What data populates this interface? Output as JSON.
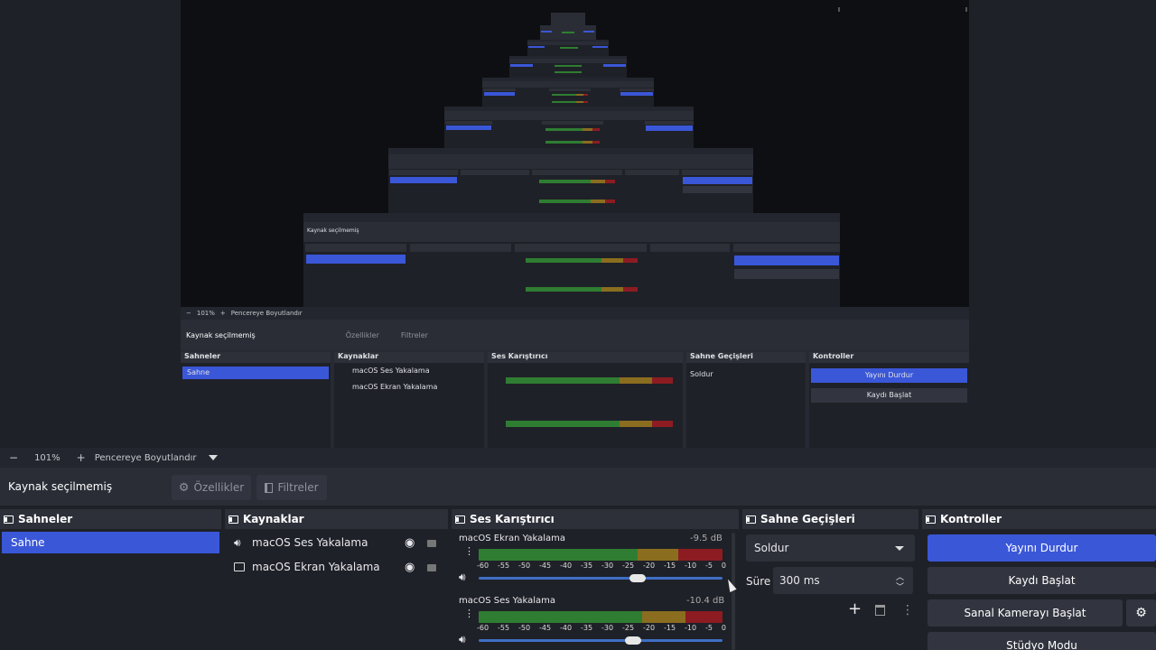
{
  "zoom": {
    "minus": "−",
    "value": "101%",
    "plus": "+",
    "fit": "Pencereye Boyutlandır"
  },
  "source_bar": {
    "title": "Kaynak seçilmemiş",
    "properties": "Özellikler",
    "filters": "Filtreler"
  },
  "scenes": {
    "title": "Sahneler",
    "items": [
      "Sahne"
    ]
  },
  "sources": {
    "title": "Kaynaklar",
    "items": [
      "macOS Ses Yakalama",
      "macOS Ekran Yakalama"
    ]
  },
  "mixer": {
    "title": "Ses Karıştırıcı",
    "channels": [
      {
        "name": "macOS Ekran Yakalama",
        "db": "-9.5 dB",
        "volume": 0.82
      },
      {
        "name": "macOS Ses Yakalama",
        "db": "-10.4 dB",
        "volume": 0.8
      }
    ],
    "ticks": [
      "-60",
      "-55",
      "-50",
      "-45",
      "-40",
      "-35",
      "-30",
      "-25",
      "-20",
      "-15",
      "-10",
      "-5",
      "0"
    ]
  },
  "transitions": {
    "title": "Sahne Geçişleri",
    "type": "Soldur",
    "duration_label": "Süre",
    "duration": "300 ms"
  },
  "controls": {
    "title": "Kontroller",
    "stop_stream": "Yayını Durdur",
    "start_record": "Kaydı Başlat",
    "virtual_cam": "Sanal Kamerayı Başlat",
    "studio_mode": "Stüdyo Modu"
  },
  "colors": {
    "accent": "#3a57d8",
    "bg": "#1f2128",
    "panel": "#272a33"
  }
}
